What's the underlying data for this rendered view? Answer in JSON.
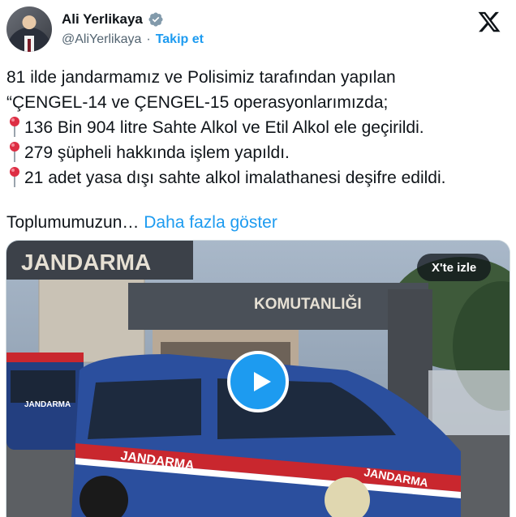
{
  "author": {
    "name": "Ali Yerlikaya",
    "handle": "@AliYerlikaya",
    "separator": "·",
    "follow_label": "Takip et"
  },
  "tweet": {
    "line1": "81 ilde jandarmamız ve Polisimiz tarafından yapılan",
    "line2": "“ÇENGEL-14 ve ÇENGEL-15 operasyonlarımızda;",
    "bullets": [
      "136 Bin 904 litre Sahte Alkol ve Etil Alkol ele geçirildi.",
      "279 şüpheli hakkında işlem yapıldı.",
      "21 adet yasa dışı sahte alkol imalathanesi deşifre edildi."
    ],
    "truncated_text": "Toplumumuzun…",
    "show_more_label": "Daha fazla göster"
  },
  "media": {
    "watch_label": "X'te izle",
    "sign_main": "JANDARMA",
    "sign_sub": "KOMUTANLIĞI",
    "van_label": "JANDARMA",
    "van_side_label": "JANDARMA",
    "left_van_label": "JANDARMA"
  },
  "colors": {
    "accent": "#1d9bf0",
    "text": "#0f1419",
    "muted": "#536471",
    "van_blue": "#2b4f9e",
    "stripe_red": "#c9272e"
  },
  "icons": [
    "verified-badge-icon",
    "x-logo-icon",
    "pin-icon",
    "play-icon"
  ]
}
